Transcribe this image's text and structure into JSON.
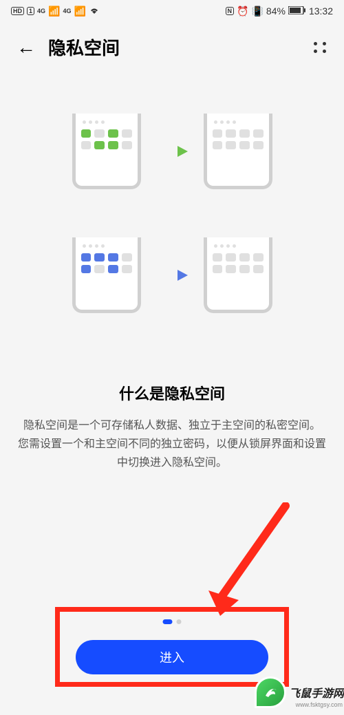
{
  "status_bar": {
    "hd": "HD",
    "sim1": "1",
    "signal1_label": "4G",
    "signal2_label": "4G",
    "nfc": "N",
    "battery_pct": "84%",
    "time": "13:32"
  },
  "header": {
    "title": "隐私空间"
  },
  "content": {
    "section_title": "什么是隐私空间",
    "desc_line1": "隐私空间是一个可存储私人数据、独立于主空间的私密空间。",
    "desc_line2": "您需设置一个和主空间不同的独立密码，以便从锁屏界面和设置中切换进入隐私空间。"
  },
  "button": {
    "enter": "进入"
  },
  "watermark": {
    "brand": "飞鼠手游网",
    "url": "www.fsktgsy.com"
  }
}
